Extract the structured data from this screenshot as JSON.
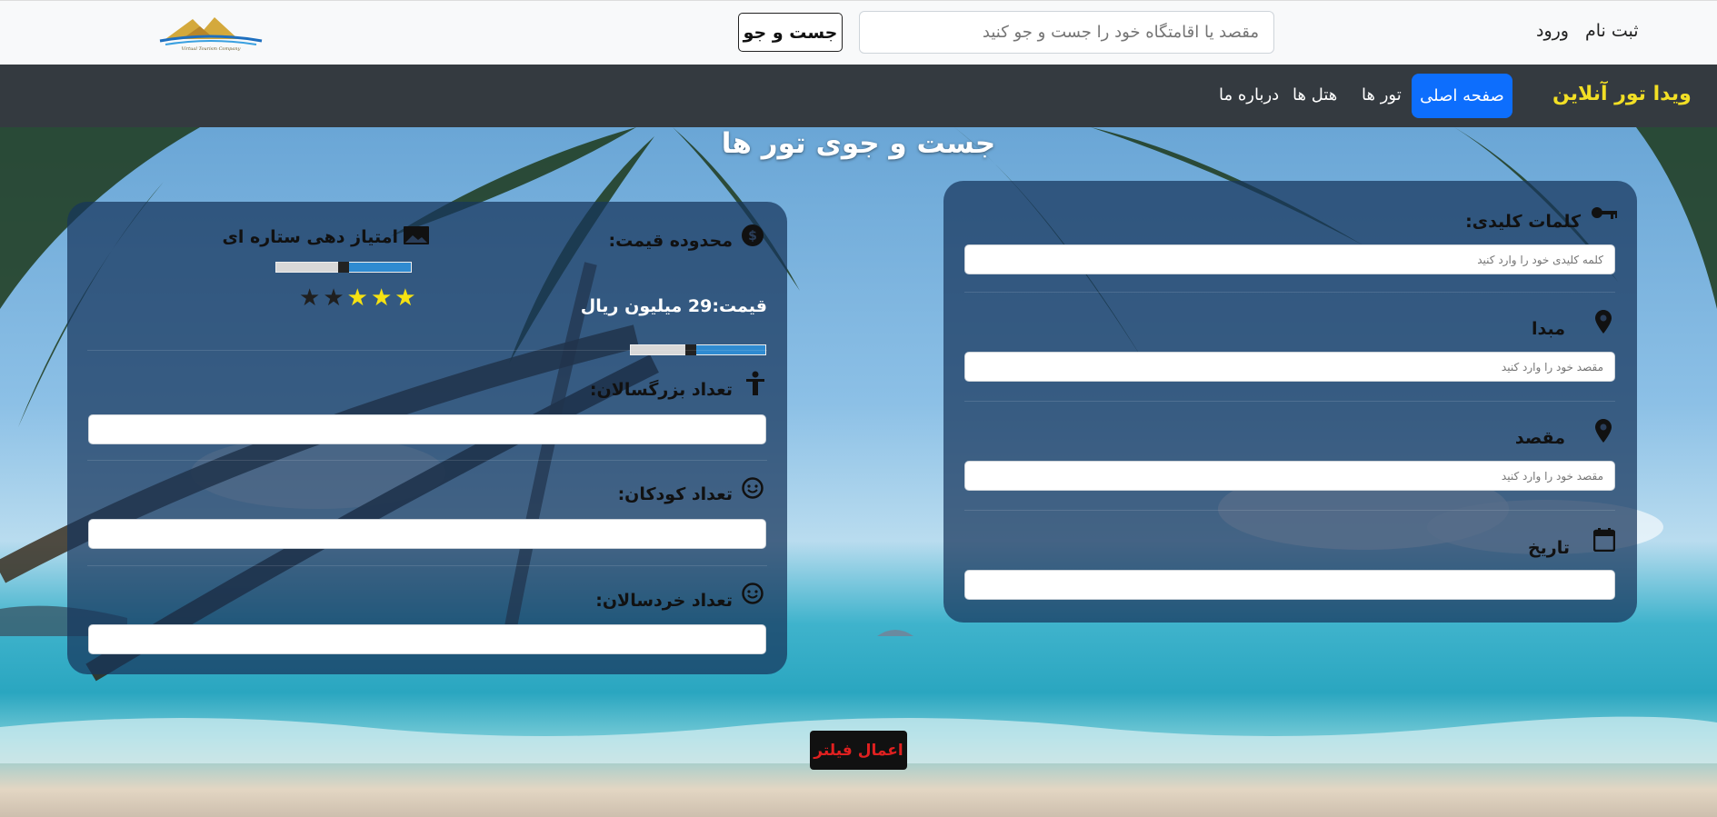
{
  "topbar": {
    "search_button": "جست و جو",
    "search_placeholder": "مقصد یا اقامتگاه خود را جست و جو کنید",
    "login": "ورود",
    "signup": "ثبت نام"
  },
  "navbar": {
    "brand": "ویدا تور آنلاین",
    "items": [
      "صفحه اصلی",
      "تور ها",
      "هتل ها",
      "درباره ما"
    ],
    "active_index": 0
  },
  "page": {
    "title": "جست و جوی تور ها"
  },
  "search_form": {
    "keywords_label": "کلمات کلیدی:",
    "keywords_placeholder": "کلمه کلیدی خود را وارد کنید",
    "origin_label": "مبدا",
    "origin_placeholder": "مقصد خود را وارد کنید",
    "destination_label": "مقصد",
    "destination_placeholder": "مقصد خود را وارد کنید",
    "date_label": "تاریخ",
    "date_value": ""
  },
  "filters": {
    "price_label": "محدوده قیمت:",
    "price_text": "قیمت:29 میلیون ریال",
    "price_fraction": 0.4,
    "rating_label": "امتیاز دهی ستاره ای",
    "rating_fraction": 0.55,
    "rating_value": 3,
    "rating_max": 5,
    "adults_label": "تعداد بزرگسالان:",
    "children_label": "تعداد کودکان:",
    "infants_label": "تعداد خردسالان:",
    "apply_button": "اعمال فیلتر"
  },
  "colors": {
    "brand": "#f2df25",
    "active_nav": "#0d6efd",
    "star_on": "#f5e212",
    "star_off": "#1f1f1f",
    "apply_text": "#e02020"
  }
}
